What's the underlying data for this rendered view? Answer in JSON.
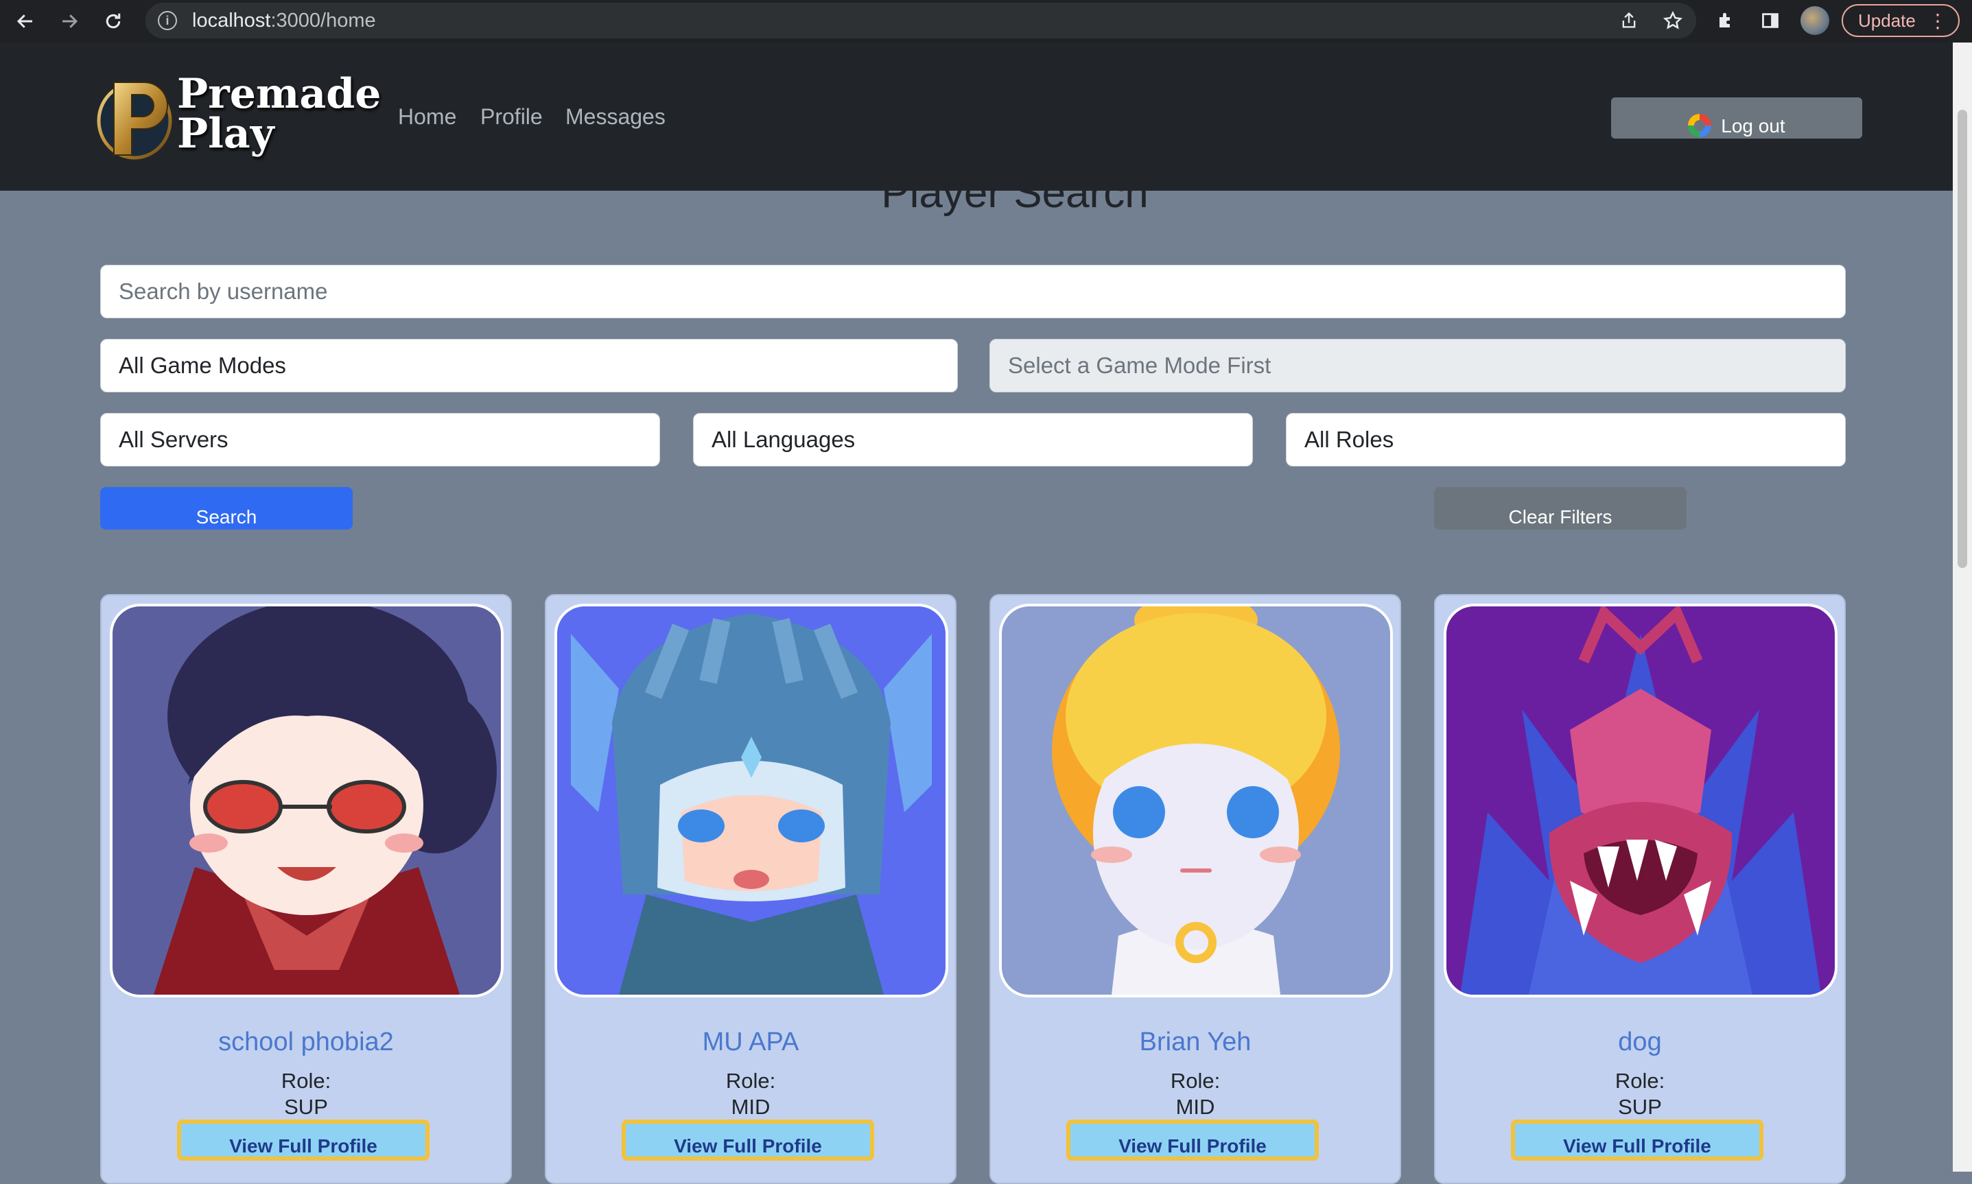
{
  "browser": {
    "url_host": "localhost",
    "url_path": ":3000/home",
    "update_label": "Update",
    "back_icon": "arrow-left-icon",
    "forward_icon": "arrow-right-icon",
    "reload_icon": "reload-icon",
    "menu_icon": "three-dots-icon"
  },
  "header": {
    "logo_line1": "Premade",
    "logo_line2": "Play",
    "nav": [
      "Home",
      "Profile",
      "Messages"
    ],
    "logout_label": "Log out"
  },
  "search": {
    "title": "Player Search",
    "username_placeholder": "Search by username",
    "game_mode": "All Game Modes",
    "sub_mode": "Select a Game Mode First",
    "server": "All Servers",
    "language": "All Languages",
    "role": "All Roles",
    "search_label": "Search",
    "clear_label": "Clear Filters"
  },
  "players": [
    {
      "name": "school phobia2",
      "role_label": "Role:",
      "role": "SUP",
      "button": "View Full Profile"
    },
    {
      "name": "MU APA",
      "role_label": "Role:",
      "role": "MID",
      "button": "View Full Profile"
    },
    {
      "name": "Brian Yeh",
      "role_label": "Role:",
      "role": "MID",
      "button": "View Full Profile"
    },
    {
      "name": "dog",
      "role_label": "Role:",
      "role": "SUP",
      "button": "View Full Profile"
    }
  ],
  "colors": {
    "page_bg": "#738091",
    "navbar_bg": "#212529",
    "primary": "#2f6bf2",
    "secondary": "#6c757d",
    "card_bg": "#c2d1ef",
    "name_color": "#4a78cf",
    "profile_btn_bg": "#8ed2f3",
    "profile_btn_border": "#f2c23b"
  }
}
